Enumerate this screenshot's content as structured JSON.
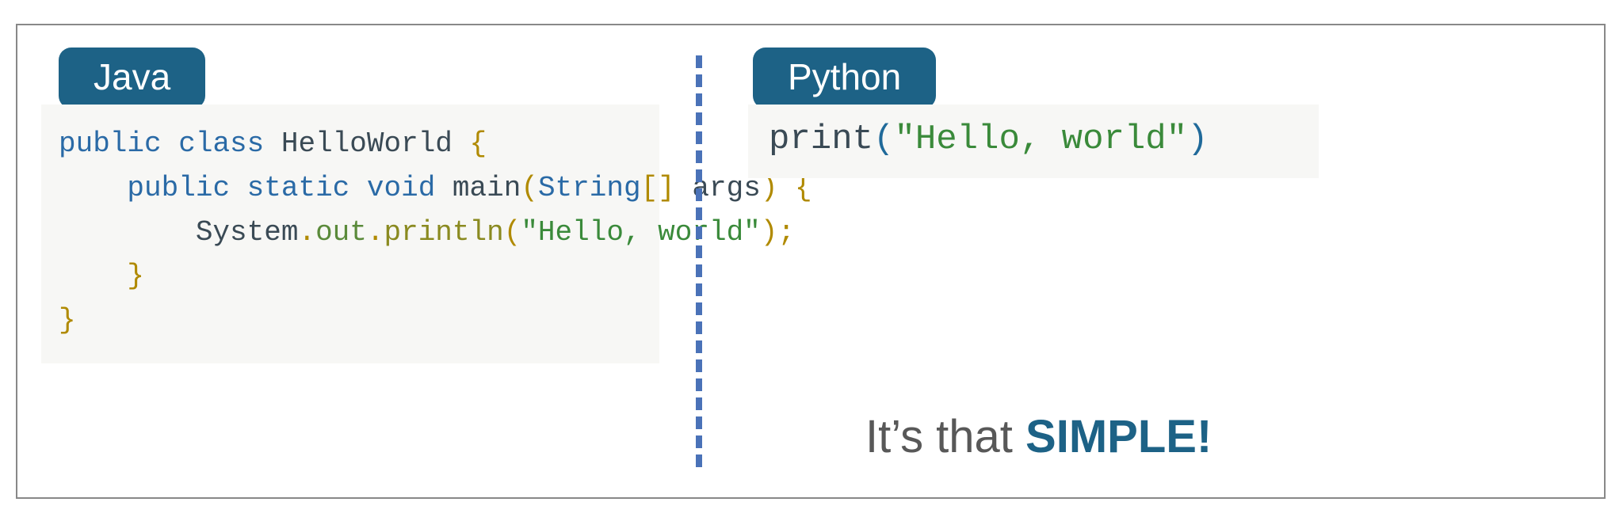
{
  "labels": {
    "java": "Java",
    "python": "Python"
  },
  "code": {
    "java": {
      "l1_kw1": "public",
      "l1_kw2": "class",
      "l1_name": "HelloWorld",
      "l1_brace": "{",
      "l2_kw1": "public",
      "l2_kw2": "static",
      "l2_kw3": "void",
      "l2_name": "main",
      "l2_lp": "(",
      "l2_type": "String",
      "l2_br": "[]",
      "l2_arg": "args",
      "l2_rp": ")",
      "l2_brace": "{",
      "l3_cls": "System",
      "l3_dot1": ".",
      "l3_field": "out",
      "l3_dot2": ".",
      "l3_method": "println",
      "l3_lp": "(",
      "l3_str": "\"Hello, world\"",
      "l3_rp": ")",
      "l3_semi": ";",
      "l4_brace": "}",
      "l5_brace": "}"
    },
    "python": {
      "call": "print",
      "lp": "(",
      "str": "\"Hello, world\"",
      "rp": ")"
    }
  },
  "tagline": {
    "part1": "It’s that ",
    "part2": "SIMPLE",
    "part3": "!"
  }
}
